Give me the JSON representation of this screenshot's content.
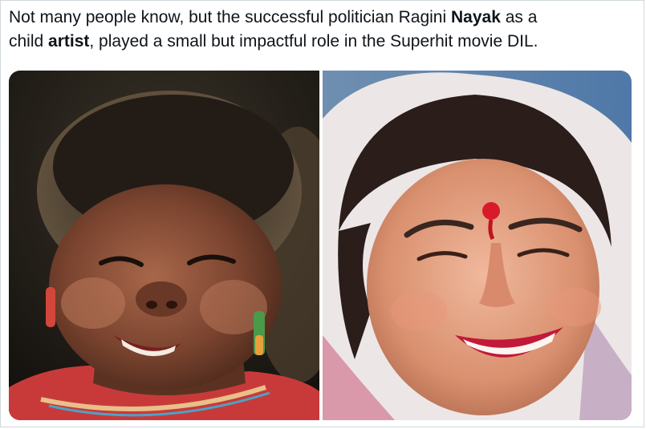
{
  "tweet": {
    "line1_a": "Not many people know, but the successful politician Ragini ",
    "line1_b": "Nayak",
    "line1_c": " as a",
    "line2_a": "child ",
    "line2_b": "artist",
    "line2_c": ", played a small but impactful role in the Superhit movie DIL."
  },
  "media": {
    "left_photo": "child-smiling-photo",
    "right_photo": "woman-with-bindi-smiling-photo"
  },
  "colors": {
    "text": "#0f1419",
    "border": "#cfd9de",
    "background": "#ffffff",
    "bindi": "#d81b2a",
    "lipstick": "#c2183a"
  }
}
